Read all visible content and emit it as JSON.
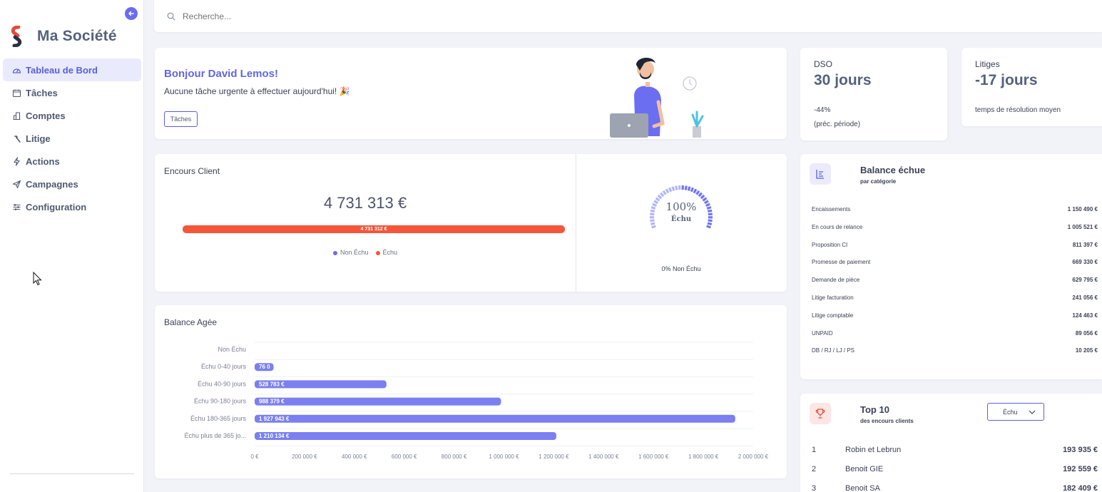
{
  "sidebar": {
    "brand": "Ma Société",
    "items": [
      {
        "label": "Tableau de Bord",
        "icon": "dashboard-icon",
        "active": true
      },
      {
        "label": "Tâches",
        "icon": "calendar-icon"
      },
      {
        "label": "Comptes",
        "icon": "building-icon"
      },
      {
        "label": "Litige",
        "icon": "hammer-icon"
      },
      {
        "label": "Actions",
        "icon": "bolt-icon"
      },
      {
        "label": "Campagnes",
        "icon": "send-icon"
      },
      {
        "label": "Configuration",
        "icon": "sliders-icon"
      }
    ]
  },
  "search": {
    "placeholder": "Recherche..."
  },
  "welcome": {
    "greeting": "Bonjour David Lemos!",
    "message": "Aucune tâche urgente à effectuer aujourd'hui! 🎉",
    "button": "Tâches"
  },
  "dso": {
    "title": "DSO",
    "value": "30 jours",
    "change": "-44%",
    "period": "(préc. période)"
  },
  "litiges": {
    "title": "Litiges",
    "value": "-17 jours",
    "caption": "temps de résolution moyen"
  },
  "encours": {
    "title": "Encours Client",
    "total": "4 731 313 €",
    "bar_label": "4 731 312 €",
    "legend_non_echu": "Non Échu",
    "legend_echu": "Échu",
    "gauge_pct": "100%",
    "gauge_label": "Échu",
    "gauge_caption": "0% Non Échu",
    "colors": {
      "non_echu": "#6c6cf0",
      "echu": "#f5563a"
    }
  },
  "chart_data": {
    "type": "bar",
    "orientation": "horizontal",
    "title": "Balance Agée",
    "categories": [
      "Non Échu",
      "Échu 0-40 jours",
      "Échu 40-90 jours",
      "Échu 90-180 jours",
      "Échu 180-365 jours",
      "Échu plus de 365 jo..."
    ],
    "values": [
      0,
      76000,
      528783,
      988379,
      1927943,
      1210134
    ],
    "data_labels": [
      "",
      "76 0",
      "528 783 €",
      "988 379 €",
      "1 927 943 €",
      "1 210 134 €"
    ],
    "xlim": [
      0,
      2000000
    ],
    "x_ticks": [
      "0 €",
      "200 000 €",
      "400 000 €",
      "600 000 €",
      "800 000 €",
      "1 000 000 €",
      "1 200 000 €",
      "1 400 000 €",
      "1 600 000 €",
      "1 800 000 €",
      "2 000 000 €"
    ],
    "color": "#7b7ff0",
    "grid": true
  },
  "balance_echue": {
    "title": "Balance échue",
    "subtitle": "par catégorie",
    "rows": [
      {
        "label": "Encaissements",
        "value": "1 150 490 €"
      },
      {
        "label": "En cours de relance",
        "value": "1 005 521 €"
      },
      {
        "label": "Proposition CI",
        "value": "811 397 €"
      },
      {
        "label": "Promesse de paiement",
        "value": "669 330 €"
      },
      {
        "label": "Demande de pièce",
        "value": "629 795 €"
      },
      {
        "label": "Litige facturation",
        "value": "241 056 €"
      },
      {
        "label": "Litige comptable",
        "value": "124 463 €"
      },
      {
        "label": "UNPAID",
        "value": "89 056 €"
      },
      {
        "label": "DB / RJ / LJ / PS",
        "value": "10 205 €"
      }
    ]
  },
  "top10": {
    "title": "Top 10",
    "subtitle": "des encours clients",
    "filter": "Échu",
    "rows": [
      {
        "rank": "1",
        "name": "Robin et Lebrun",
        "value": "193 935 €"
      },
      {
        "rank": "2",
        "name": "Benoit GIE",
        "value": "192 559 €"
      },
      {
        "rank": "3",
        "name": "Benoit SA",
        "value": "182 409 €"
      }
    ]
  }
}
